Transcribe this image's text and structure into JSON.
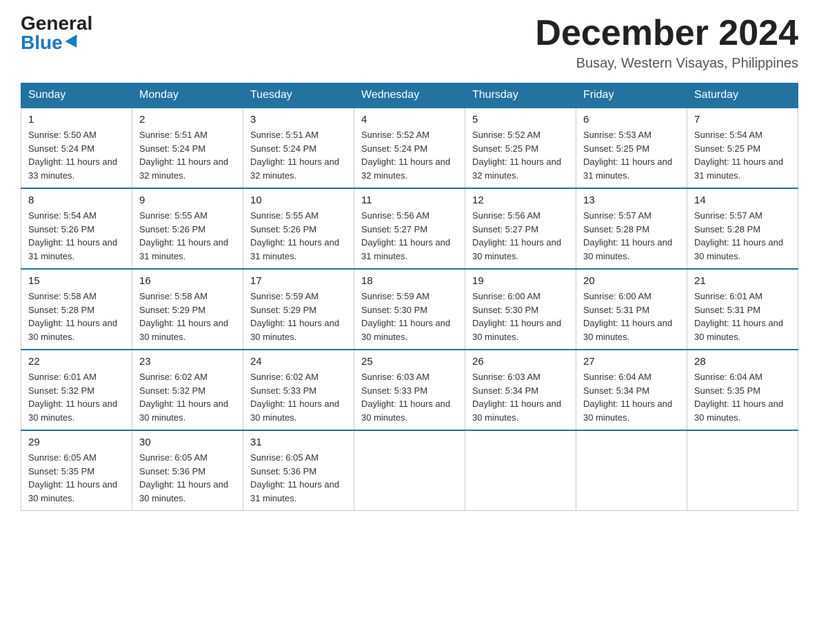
{
  "header": {
    "logo_general": "General",
    "logo_blue": "Blue",
    "month_title": "December 2024",
    "location": "Busay, Western Visayas, Philippines"
  },
  "weekdays": [
    "Sunday",
    "Monday",
    "Tuesday",
    "Wednesday",
    "Thursday",
    "Friday",
    "Saturday"
  ],
  "weeks": [
    [
      {
        "day": "1",
        "sunrise": "5:50 AM",
        "sunset": "5:24 PM",
        "daylight": "11 hours and 33 minutes."
      },
      {
        "day": "2",
        "sunrise": "5:51 AM",
        "sunset": "5:24 PM",
        "daylight": "11 hours and 32 minutes."
      },
      {
        "day": "3",
        "sunrise": "5:51 AM",
        "sunset": "5:24 PM",
        "daylight": "11 hours and 32 minutes."
      },
      {
        "day": "4",
        "sunrise": "5:52 AM",
        "sunset": "5:24 PM",
        "daylight": "11 hours and 32 minutes."
      },
      {
        "day": "5",
        "sunrise": "5:52 AM",
        "sunset": "5:25 PM",
        "daylight": "11 hours and 32 minutes."
      },
      {
        "day": "6",
        "sunrise": "5:53 AM",
        "sunset": "5:25 PM",
        "daylight": "11 hours and 31 minutes."
      },
      {
        "day": "7",
        "sunrise": "5:54 AM",
        "sunset": "5:25 PM",
        "daylight": "11 hours and 31 minutes."
      }
    ],
    [
      {
        "day": "8",
        "sunrise": "5:54 AM",
        "sunset": "5:26 PM",
        "daylight": "11 hours and 31 minutes."
      },
      {
        "day": "9",
        "sunrise": "5:55 AM",
        "sunset": "5:26 PM",
        "daylight": "11 hours and 31 minutes."
      },
      {
        "day": "10",
        "sunrise": "5:55 AM",
        "sunset": "5:26 PM",
        "daylight": "11 hours and 31 minutes."
      },
      {
        "day": "11",
        "sunrise": "5:56 AM",
        "sunset": "5:27 PM",
        "daylight": "11 hours and 31 minutes."
      },
      {
        "day": "12",
        "sunrise": "5:56 AM",
        "sunset": "5:27 PM",
        "daylight": "11 hours and 30 minutes."
      },
      {
        "day": "13",
        "sunrise": "5:57 AM",
        "sunset": "5:28 PM",
        "daylight": "11 hours and 30 minutes."
      },
      {
        "day": "14",
        "sunrise": "5:57 AM",
        "sunset": "5:28 PM",
        "daylight": "11 hours and 30 minutes."
      }
    ],
    [
      {
        "day": "15",
        "sunrise": "5:58 AM",
        "sunset": "5:28 PM",
        "daylight": "11 hours and 30 minutes."
      },
      {
        "day": "16",
        "sunrise": "5:58 AM",
        "sunset": "5:29 PM",
        "daylight": "11 hours and 30 minutes."
      },
      {
        "day": "17",
        "sunrise": "5:59 AM",
        "sunset": "5:29 PM",
        "daylight": "11 hours and 30 minutes."
      },
      {
        "day": "18",
        "sunrise": "5:59 AM",
        "sunset": "5:30 PM",
        "daylight": "11 hours and 30 minutes."
      },
      {
        "day": "19",
        "sunrise": "6:00 AM",
        "sunset": "5:30 PM",
        "daylight": "11 hours and 30 minutes."
      },
      {
        "day": "20",
        "sunrise": "6:00 AM",
        "sunset": "5:31 PM",
        "daylight": "11 hours and 30 minutes."
      },
      {
        "day": "21",
        "sunrise": "6:01 AM",
        "sunset": "5:31 PM",
        "daylight": "11 hours and 30 minutes."
      }
    ],
    [
      {
        "day": "22",
        "sunrise": "6:01 AM",
        "sunset": "5:32 PM",
        "daylight": "11 hours and 30 minutes."
      },
      {
        "day": "23",
        "sunrise": "6:02 AM",
        "sunset": "5:32 PM",
        "daylight": "11 hours and 30 minutes."
      },
      {
        "day": "24",
        "sunrise": "6:02 AM",
        "sunset": "5:33 PM",
        "daylight": "11 hours and 30 minutes."
      },
      {
        "day": "25",
        "sunrise": "6:03 AM",
        "sunset": "5:33 PM",
        "daylight": "11 hours and 30 minutes."
      },
      {
        "day": "26",
        "sunrise": "6:03 AM",
        "sunset": "5:34 PM",
        "daylight": "11 hours and 30 minutes."
      },
      {
        "day": "27",
        "sunrise": "6:04 AM",
        "sunset": "5:34 PM",
        "daylight": "11 hours and 30 minutes."
      },
      {
        "day": "28",
        "sunrise": "6:04 AM",
        "sunset": "5:35 PM",
        "daylight": "11 hours and 30 minutes."
      }
    ],
    [
      {
        "day": "29",
        "sunrise": "6:05 AM",
        "sunset": "5:35 PM",
        "daylight": "11 hours and 30 minutes."
      },
      {
        "day": "30",
        "sunrise": "6:05 AM",
        "sunset": "5:36 PM",
        "daylight": "11 hours and 30 minutes."
      },
      {
        "day": "31",
        "sunrise": "6:05 AM",
        "sunset": "5:36 PM",
        "daylight": "11 hours and 31 minutes."
      },
      null,
      null,
      null,
      null
    ]
  ]
}
